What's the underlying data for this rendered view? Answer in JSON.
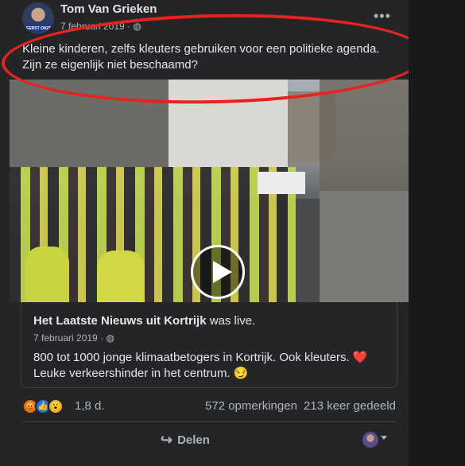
{
  "post": {
    "author": "Tom Van Grieken",
    "avatar_badge": "EERST ONZE MENSEN",
    "date": "7 februari 2019",
    "privacy_icon": "globe-icon",
    "more_icon": "•••",
    "text": "Kleine kinderen, zelfs kleuters gebruiken voor een politieke agenda. Zijn ze eigenlijk niet beschaamd?"
  },
  "shared": {
    "page_name": "Het Laatste Nieuws uit Kortrijk",
    "was_live": "was live.",
    "date": "7 februari 2019",
    "text": "800 tot 1000 jonge klimaatbetogers in Kortrijk. Ook kleuters. ❤️ Leuke verkeershinder in het centrum. 😏"
  },
  "stats": {
    "reactions": [
      "angry",
      "like",
      "wow"
    ],
    "reaction_count": "1,8 d.",
    "comments": "572 opmerkingen",
    "shares": "213 keer gedeeld"
  },
  "actions": {
    "share_label": "Delen",
    "share_icon": "↪"
  },
  "colors": {
    "annotation": "#e8231c",
    "background": "#242526",
    "text": "#e4e6eb",
    "secondary": "#b0b3b8"
  }
}
